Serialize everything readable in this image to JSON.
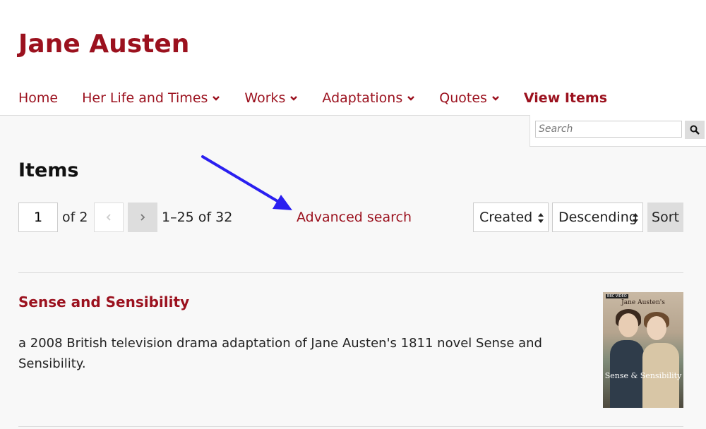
{
  "site": {
    "title": "Jane Austen"
  },
  "nav": {
    "items": [
      {
        "label": "Home"
      },
      {
        "label": "Her Life and Times"
      },
      {
        "label": "Works"
      },
      {
        "label": "Adaptations"
      },
      {
        "label": "Quotes"
      },
      {
        "label": "View Items"
      }
    ]
  },
  "search": {
    "placeholder": "Search"
  },
  "page": {
    "title": "Items"
  },
  "pagination": {
    "current_page": "1",
    "of_text": "of 2",
    "range_text": "1–25 of 32"
  },
  "advanced_search": {
    "label": "Advanced search"
  },
  "sort": {
    "by_value": "Created",
    "order_value": "Descending",
    "button_label": "Sort"
  },
  "items": [
    {
      "title": "Sense and Sensibility",
      "description": "a 2008 British television drama adaptation of Jane Austen's 1811 novel Sense and Sensibility.",
      "thumbnail": {
        "badge": "BBC VIDEO",
        "author_text": "Jane Austen's",
        "title_text": "Sense & Sensibility"
      }
    }
  ],
  "colors": {
    "brand": "#9b111e",
    "annotation_arrow": "#2a1ff0"
  }
}
